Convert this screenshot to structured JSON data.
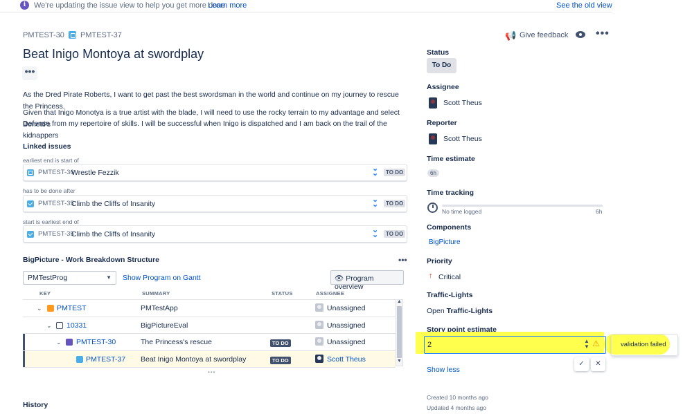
{
  "banner": {
    "text": "We're updating the issue view to help you get more done.",
    "learn_more": "Learn more",
    "old_view": "See the old view"
  },
  "breadcrumb": {
    "parent": "PMTEST-30",
    "separator": "/",
    "current": "PMTEST-37"
  },
  "header": {
    "feedback": "Give feedback",
    "more": "•••"
  },
  "issue": {
    "title": "Beat Inigo Montoya at swordplay",
    "more": "•••",
    "description": [
      "As the Dred Pirate Roberts, I want to get past the best swordsman in the world and continue on my journey to rescue the Princess.",
      "Given that Inigo Monotya is a true artist with the blade, I will need to use the rocky terrain to my advantage and select Bonetti's",
      "Defense from my repertoire of skills. I will be successful when Inigo is dispatched and I am back on the trail of the kidnappers"
    ]
  },
  "linked_issues": {
    "title": "Linked issues",
    "groups": [
      {
        "category": "earliest end is start of",
        "key": "PMTEST-36",
        "summary": "Wrestle Fezzik",
        "status": "TO DO"
      },
      {
        "category": "has to be done after",
        "key": "PMTEST-35",
        "summary": "Climb the Cliffs of Insanity",
        "status": "TO DO"
      },
      {
        "category": "start is earliest end of",
        "key": "PMTEST-35",
        "summary": "Climb the Cliffs of Insanity",
        "status": "TO DO"
      }
    ]
  },
  "wbs": {
    "title": "BigPicture - Work Breakdown Structure",
    "more": "•••",
    "program_select": "PMTestProg",
    "gantt_link": "Show Program on Gantt",
    "overview_button": "Program overview",
    "columns": [
      "KEY",
      "SUMMARY",
      "STATUS",
      "ASSIGNEE"
    ],
    "rows": [
      {
        "key": "PMTEST",
        "summary": "PMTestApp",
        "status": "",
        "assignee": "Unassigned"
      },
      {
        "key": "10331",
        "summary": "BigPictureEval",
        "status": "",
        "assignee": "Unassigned"
      },
      {
        "key": "PMTEST-30",
        "summary": "The Princess's rescue",
        "status": "TO DO",
        "assignee": "Unassigned"
      },
      {
        "key": "PMTEST-37",
        "summary": "Beat Inigo Montoya at swordplay",
        "status": "TO DO",
        "assignee": "Scott Theus"
      }
    ],
    "resize": "•••"
  },
  "history": {
    "title": "History"
  },
  "sidebar": {
    "status_label": "Status",
    "status_value": "To Do",
    "assignee_label": "Assignee",
    "assignee_value": "Scott Theus",
    "reporter_label": "Reporter",
    "reporter_value": "Scott Theus",
    "time_estimate_label": "Time estimate",
    "time_estimate_value": "6h",
    "time_tracking_label": "Time tracking",
    "time_tracking_logged": "No time logged",
    "time_tracking_total": "6h",
    "components_label": "Components",
    "components_value": "BigPicture",
    "priority_label": "Priority",
    "priority_value": "Critical",
    "traffic_label": "Traffic-Lights",
    "traffic_prefix": "Open",
    "traffic_value": "Traffic-Lights",
    "story_points_label": "Story point estimate",
    "story_points_value": "2",
    "validation_message": "validation failed",
    "confirm": "✓",
    "cancel": "✕",
    "show_less": "Show less",
    "created": "Created 10 months ago",
    "updated": "Updated 4 months ago"
  },
  "colors": {
    "link": "#0052cc",
    "highlight": "#ffff4d",
    "focus": "#2684ff",
    "warning": "#ff8b00",
    "priority_critical": "#de350b"
  }
}
